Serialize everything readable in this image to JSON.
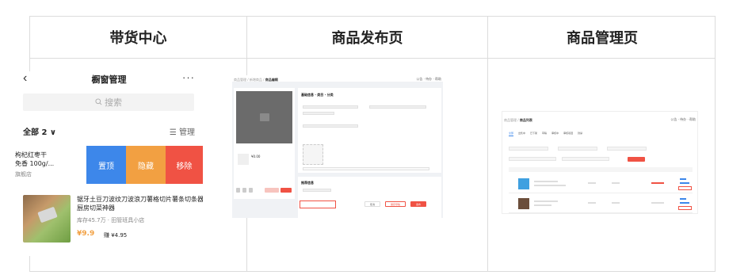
{
  "headers": {
    "col1": "带货中心",
    "col2": "商品发布页",
    "col3": "商品管理页"
  },
  "phone": {
    "title": "橱窗管理",
    "back_icon": "chevron-left-icon",
    "more": "···",
    "search_placeholder": "搜索",
    "filter": "全部 2 ∨",
    "manage": "☰ 管理",
    "swiped_item": {
      "name_line1": "枸杞红枣干",
      "name_line2": "免香 100g/...",
      "shop": "旗舰店"
    },
    "actions": {
      "pin": "置顶",
      "hide": "隐藏",
      "remove": "移除"
    },
    "product": {
      "name": "锯牙土豆刀波纹刀波浪刀薯格切片薯条切条器厨房切菜神器",
      "meta": "库存45.7万 · 田管班具小店",
      "price": "¥9.9",
      "earn": "赚 ¥4.95"
    }
  },
  "publish_page": {
    "breadcrumb_prefix": "商品管理 / 新增商品 / ",
    "breadcrumb_current": "商品编辑",
    "top_right": "公告 · 待办 · 帮助",
    "form_title": "基础信息 · 类目 · 分类",
    "price": "¥0.00",
    "recommend_title": "推荐信息",
    "btn_cancel": "取消",
    "btn_save": "保存草稿",
    "btn_submit": "发布"
  },
  "manage_page": {
    "breadcrumb_prefix": "商品管理 / ",
    "breadcrumb_current": "商品列表",
    "top_right": "公告 · 待办 · 帮助",
    "tabs": [
      "全部",
      "出售中",
      "已下架",
      "草稿",
      "审核中",
      "审核驳回",
      "封禁"
    ]
  }
}
